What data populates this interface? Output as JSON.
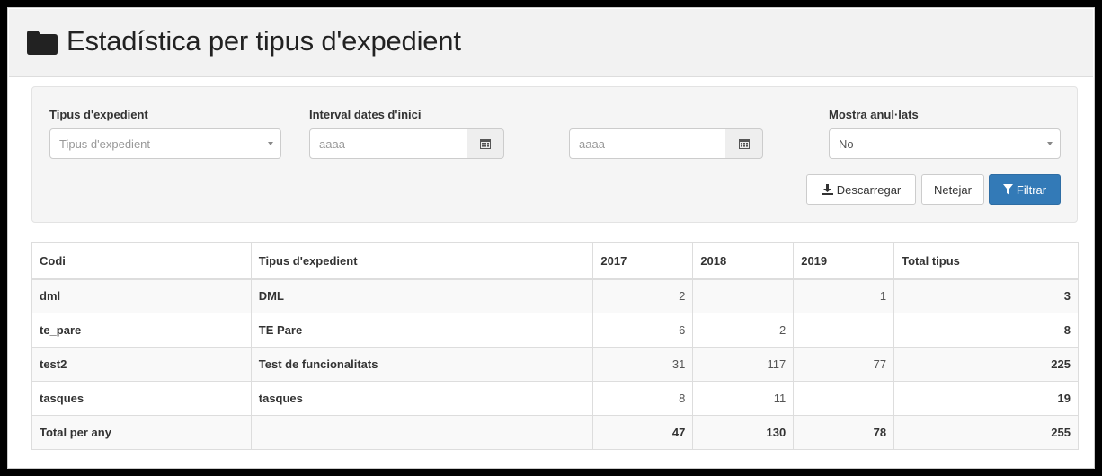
{
  "header": {
    "title": "Estadística per tipus d'expedient",
    "icon": "folder-icon"
  },
  "filters": {
    "type_label": "Tipus d'expedient",
    "type_placeholder": "Tipus d'expedient",
    "date_label": "Interval dates d'inici",
    "date_from_placeholder": "aaaa",
    "date_to_placeholder": "aaaa",
    "cancelled_label": "Mostra anul·lats",
    "cancelled_value": "No"
  },
  "buttons": {
    "download": "Descarregar",
    "clear": "Netejar",
    "filter": "Filtrar"
  },
  "table": {
    "columns": [
      "Codi",
      "Tipus d'expedient",
      "2017",
      "2018",
      "2019",
      "Total tipus"
    ],
    "rows": [
      {
        "code": "dml",
        "name": "DML",
        "y2017": "2",
        "y2018": "",
        "y2019": "1",
        "total": "3"
      },
      {
        "code": "te_pare",
        "name": "TE Pare",
        "y2017": "6",
        "y2018": "2",
        "y2019": "",
        "total": "8"
      },
      {
        "code": "test2",
        "name": "Test de funcionalitats",
        "y2017": "31",
        "y2018": "117",
        "y2019": "77",
        "total": "225"
      },
      {
        "code": "tasques",
        "name": "tasques",
        "y2017": "8",
        "y2018": "11",
        "y2019": "",
        "total": "19"
      }
    ],
    "total_row": {
      "label": "Total per any",
      "y2017": "47",
      "y2018": "130",
      "y2019": "78",
      "total": "255"
    }
  },
  "colors": {
    "primary": "#337ab7",
    "panel": "#f5f5f5",
    "header": "#f2f2f2"
  }
}
